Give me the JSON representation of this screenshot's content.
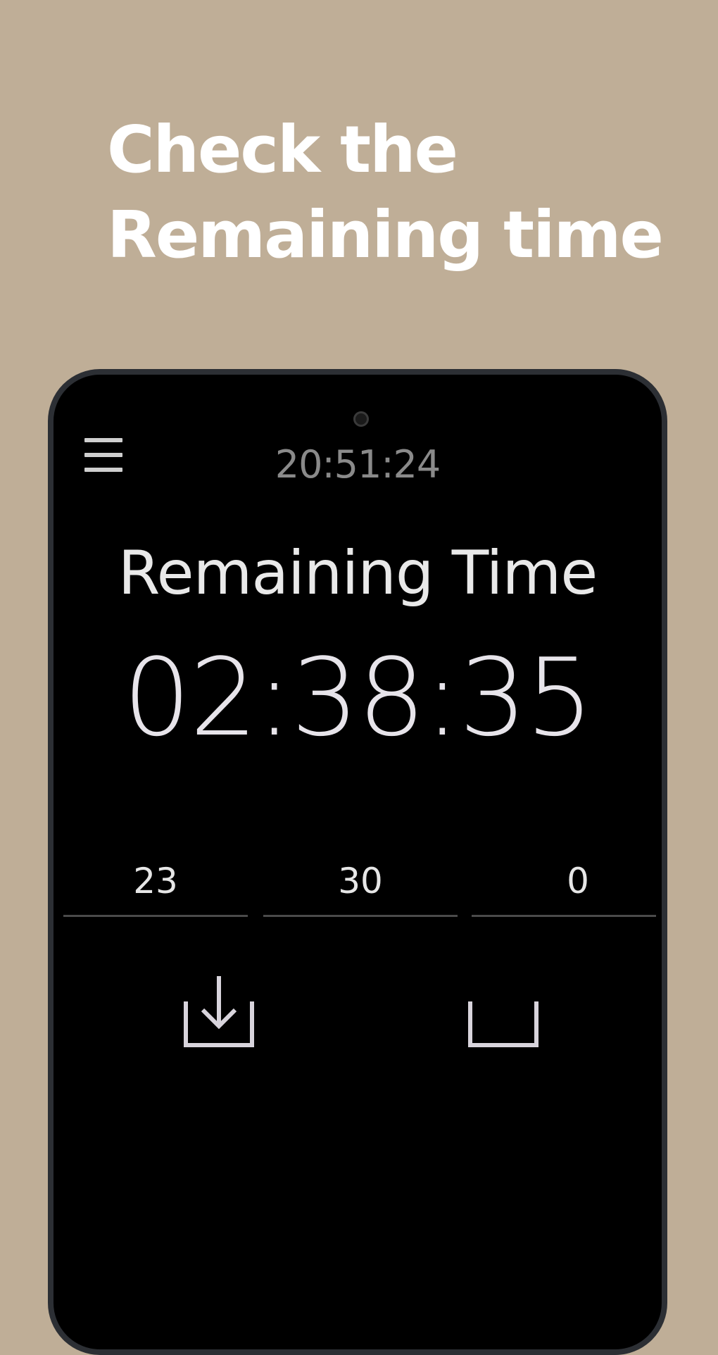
{
  "promo": {
    "headline_line1": "Check the",
    "headline_line2": "Remaining time"
  },
  "status_bar": {
    "clock": "20:51:24"
  },
  "timer": {
    "label": "Remaining Time",
    "value": "02:38:35"
  },
  "inputs": [
    {
      "value": "23"
    },
    {
      "value": "30"
    },
    {
      "value": "0"
    }
  ],
  "icons": {
    "menu": "hamburger-menu-icon",
    "import": "download-tray-icon",
    "box": "empty-tray-icon"
  },
  "colors": {
    "background": "#bfae97",
    "phone_screen": "#000000",
    "headline_text": "#ffffff"
  }
}
